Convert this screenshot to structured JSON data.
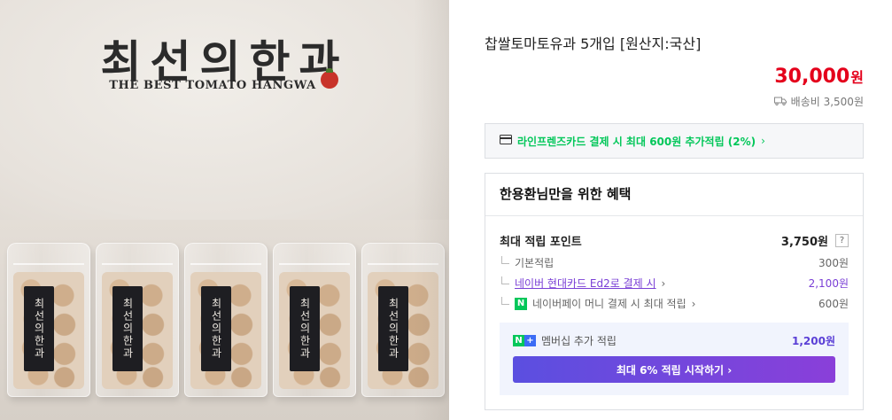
{
  "image": {
    "brand_title": "최선의한과",
    "brand_subtitle": "THE BEST TOMATO HANGWA",
    "bag_label": "최선의한과"
  },
  "product": {
    "title": "찹쌀토마토유과 5개입 [원산지:국산]",
    "price": "30,000",
    "price_unit": "원",
    "shipping": "배송비 3,500원"
  },
  "card_promo": {
    "icon": "credit-card-icon",
    "text": "라인프렌즈카드 결제 시 최대 600원 추가적립 (2%)",
    "chevron": "›"
  },
  "benefits": {
    "header": "한용환님만을 위한 혜택",
    "max_points_label": "최대 적립 포인트",
    "max_points_value": "3,750원",
    "help": "?",
    "items": [
      {
        "label": "기본적립",
        "value": "300원"
      },
      {
        "label": "네이버 현대카드 Ed2로 결제 시",
        "value": "2,100원"
      },
      {
        "label": "네이버페이 머니 결제 시 최대 적립",
        "value": "600원"
      }
    ],
    "chevron": "›",
    "npay_mark": "N",
    "membership": {
      "badge_n": "N",
      "badge_plus": "+",
      "label": "멤버십 추가 적립",
      "value": "1,200원",
      "cta": "최대 6% 적립 시작하기 ›"
    }
  },
  "colors": {
    "price": "#e4001b",
    "green": "#03c75a",
    "purple": "#7a3fd6",
    "cta_start": "#5b4fe0",
    "cta_end": "#8a3fd9"
  }
}
